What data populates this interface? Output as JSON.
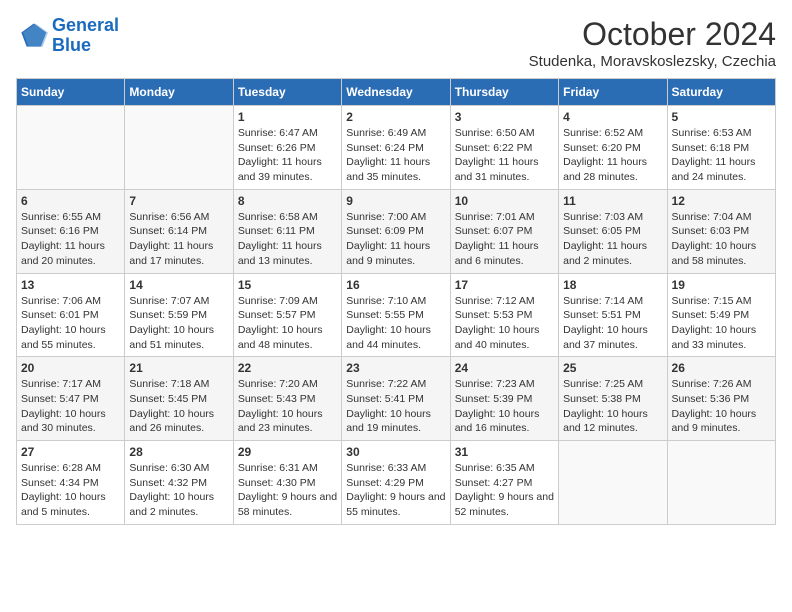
{
  "header": {
    "logo_line1": "General",
    "logo_line2": "Blue",
    "month": "October 2024",
    "location": "Studenka, Moravskoslezsky, Czechia"
  },
  "weekdays": [
    "Sunday",
    "Monday",
    "Tuesday",
    "Wednesday",
    "Thursday",
    "Friday",
    "Saturday"
  ],
  "weeks": [
    [
      {
        "day": "",
        "sunrise": "",
        "sunset": "",
        "daylight": ""
      },
      {
        "day": "",
        "sunrise": "",
        "sunset": "",
        "daylight": ""
      },
      {
        "day": "1",
        "sunrise": "Sunrise: 6:47 AM",
        "sunset": "Sunset: 6:26 PM",
        "daylight": "Daylight: 11 hours and 39 minutes."
      },
      {
        "day": "2",
        "sunrise": "Sunrise: 6:49 AM",
        "sunset": "Sunset: 6:24 PM",
        "daylight": "Daylight: 11 hours and 35 minutes."
      },
      {
        "day": "3",
        "sunrise": "Sunrise: 6:50 AM",
        "sunset": "Sunset: 6:22 PM",
        "daylight": "Daylight: 11 hours and 31 minutes."
      },
      {
        "day": "4",
        "sunrise": "Sunrise: 6:52 AM",
        "sunset": "Sunset: 6:20 PM",
        "daylight": "Daylight: 11 hours and 28 minutes."
      },
      {
        "day": "5",
        "sunrise": "Sunrise: 6:53 AM",
        "sunset": "Sunset: 6:18 PM",
        "daylight": "Daylight: 11 hours and 24 minutes."
      }
    ],
    [
      {
        "day": "6",
        "sunrise": "Sunrise: 6:55 AM",
        "sunset": "Sunset: 6:16 PM",
        "daylight": "Daylight: 11 hours and 20 minutes."
      },
      {
        "day": "7",
        "sunrise": "Sunrise: 6:56 AM",
        "sunset": "Sunset: 6:14 PM",
        "daylight": "Daylight: 11 hours and 17 minutes."
      },
      {
        "day": "8",
        "sunrise": "Sunrise: 6:58 AM",
        "sunset": "Sunset: 6:11 PM",
        "daylight": "Daylight: 11 hours and 13 minutes."
      },
      {
        "day": "9",
        "sunrise": "Sunrise: 7:00 AM",
        "sunset": "Sunset: 6:09 PM",
        "daylight": "Daylight: 11 hours and 9 minutes."
      },
      {
        "day": "10",
        "sunrise": "Sunrise: 7:01 AM",
        "sunset": "Sunset: 6:07 PM",
        "daylight": "Daylight: 11 hours and 6 minutes."
      },
      {
        "day": "11",
        "sunrise": "Sunrise: 7:03 AM",
        "sunset": "Sunset: 6:05 PM",
        "daylight": "Daylight: 11 hours and 2 minutes."
      },
      {
        "day": "12",
        "sunrise": "Sunrise: 7:04 AM",
        "sunset": "Sunset: 6:03 PM",
        "daylight": "Daylight: 10 hours and 58 minutes."
      }
    ],
    [
      {
        "day": "13",
        "sunrise": "Sunrise: 7:06 AM",
        "sunset": "Sunset: 6:01 PM",
        "daylight": "Daylight: 10 hours and 55 minutes."
      },
      {
        "day": "14",
        "sunrise": "Sunrise: 7:07 AM",
        "sunset": "Sunset: 5:59 PM",
        "daylight": "Daylight: 10 hours and 51 minutes."
      },
      {
        "day": "15",
        "sunrise": "Sunrise: 7:09 AM",
        "sunset": "Sunset: 5:57 PM",
        "daylight": "Daylight: 10 hours and 48 minutes."
      },
      {
        "day": "16",
        "sunrise": "Sunrise: 7:10 AM",
        "sunset": "Sunset: 5:55 PM",
        "daylight": "Daylight: 10 hours and 44 minutes."
      },
      {
        "day": "17",
        "sunrise": "Sunrise: 7:12 AM",
        "sunset": "Sunset: 5:53 PM",
        "daylight": "Daylight: 10 hours and 40 minutes."
      },
      {
        "day": "18",
        "sunrise": "Sunrise: 7:14 AM",
        "sunset": "Sunset: 5:51 PM",
        "daylight": "Daylight: 10 hours and 37 minutes."
      },
      {
        "day": "19",
        "sunrise": "Sunrise: 7:15 AM",
        "sunset": "Sunset: 5:49 PM",
        "daylight": "Daylight: 10 hours and 33 minutes."
      }
    ],
    [
      {
        "day": "20",
        "sunrise": "Sunrise: 7:17 AM",
        "sunset": "Sunset: 5:47 PM",
        "daylight": "Daylight: 10 hours and 30 minutes."
      },
      {
        "day": "21",
        "sunrise": "Sunrise: 7:18 AM",
        "sunset": "Sunset: 5:45 PM",
        "daylight": "Daylight: 10 hours and 26 minutes."
      },
      {
        "day": "22",
        "sunrise": "Sunrise: 7:20 AM",
        "sunset": "Sunset: 5:43 PM",
        "daylight": "Daylight: 10 hours and 23 minutes."
      },
      {
        "day": "23",
        "sunrise": "Sunrise: 7:22 AM",
        "sunset": "Sunset: 5:41 PM",
        "daylight": "Daylight: 10 hours and 19 minutes."
      },
      {
        "day": "24",
        "sunrise": "Sunrise: 7:23 AM",
        "sunset": "Sunset: 5:39 PM",
        "daylight": "Daylight: 10 hours and 16 minutes."
      },
      {
        "day": "25",
        "sunrise": "Sunrise: 7:25 AM",
        "sunset": "Sunset: 5:38 PM",
        "daylight": "Daylight: 10 hours and 12 minutes."
      },
      {
        "day": "26",
        "sunrise": "Sunrise: 7:26 AM",
        "sunset": "Sunset: 5:36 PM",
        "daylight": "Daylight: 10 hours and 9 minutes."
      }
    ],
    [
      {
        "day": "27",
        "sunrise": "Sunrise: 6:28 AM",
        "sunset": "Sunset: 4:34 PM",
        "daylight": "Daylight: 10 hours and 5 minutes."
      },
      {
        "day": "28",
        "sunrise": "Sunrise: 6:30 AM",
        "sunset": "Sunset: 4:32 PM",
        "daylight": "Daylight: 10 hours and 2 minutes."
      },
      {
        "day": "29",
        "sunrise": "Sunrise: 6:31 AM",
        "sunset": "Sunset: 4:30 PM",
        "daylight": "Daylight: 9 hours and 58 minutes."
      },
      {
        "day": "30",
        "sunrise": "Sunrise: 6:33 AM",
        "sunset": "Sunset: 4:29 PM",
        "daylight": "Daylight: 9 hours and 55 minutes."
      },
      {
        "day": "31",
        "sunrise": "Sunrise: 6:35 AM",
        "sunset": "Sunset: 4:27 PM",
        "daylight": "Daylight: 9 hours and 52 minutes."
      },
      {
        "day": "",
        "sunrise": "",
        "sunset": "",
        "daylight": ""
      },
      {
        "day": "",
        "sunrise": "",
        "sunset": "",
        "daylight": ""
      }
    ]
  ]
}
